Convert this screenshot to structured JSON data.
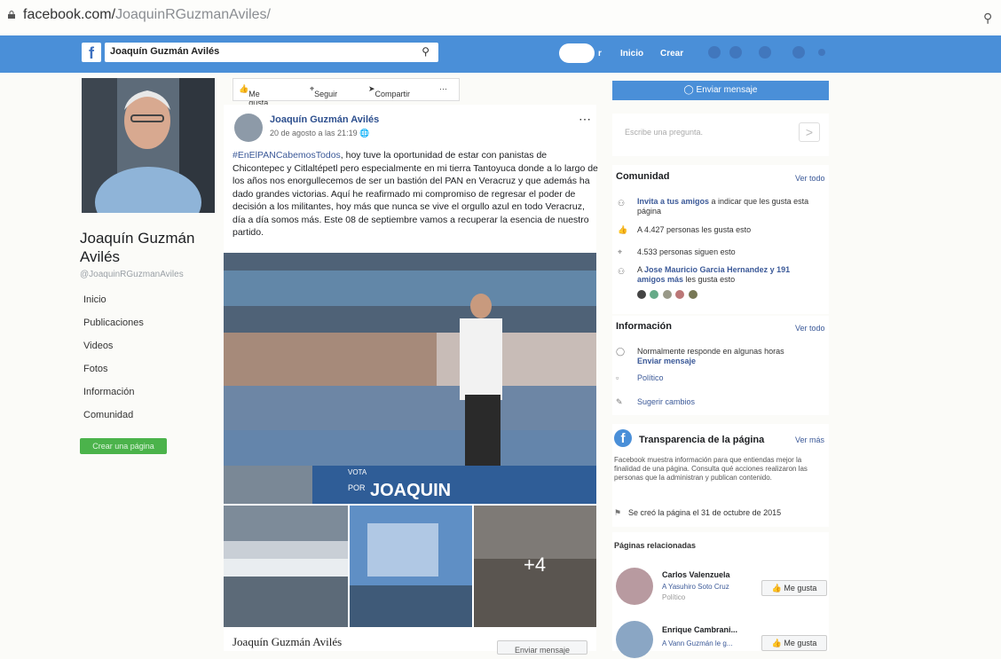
{
  "browser": {
    "url_domain": "facebook.com/",
    "url_path": "JoaquinRGuzmanAviles/"
  },
  "topbar": {
    "search_value": "Joaquín Guzmán Avilés",
    "nav": [
      "r",
      "Inicio",
      "Crear"
    ]
  },
  "profile": {
    "name": "Joaquín Guzmán Avilés",
    "handle": "@JoaquinRGuzmanAviles",
    "nav": [
      "Inicio",
      "Publicaciones",
      "Videos",
      "Fotos",
      "Información",
      "Comunidad"
    ],
    "create_page": "Crear una página"
  },
  "actions": {
    "like": "Me gusta",
    "follow": "Seguir",
    "share": "Compartir",
    "more": "···"
  },
  "post": {
    "author": "Joaquín Guzmán Avilés",
    "date": "20 de agosto a las 21:19",
    "hashtag": "#EnElPANCabemosTodos",
    "text": ", hoy tuve la oportunidad de estar con panistas de Chicontepec y Citlaltépetl pero especialmente en mi tierra Tantoyuca donde a lo largo de los años nos enorgullecemos de ser un bastión del PAN en Veracruz y que además ha dado grandes victorias. Aquí he reafirmado mi compromiso de regresar el poder de decisión a los militantes, hoy más que nunca se vive el orgullo azul en todo Veracruz, día a día somos más. Este 08 de septiembre vamos a recuperar la esencia de nuestro partido.",
    "banner_small": "VOTA",
    "banner_por": "POR",
    "banner_big": "JOAQUIN",
    "more_photos": "+4"
  },
  "footer": {
    "name": "Joaquín Guzmán Avilés",
    "button": "Enviar mensaje"
  },
  "right": {
    "send_message": "Enviar mensaje",
    "ask_placeholder": "Escribe una pregunta.",
    "community": {
      "title": "Comunidad",
      "see_all": "Ver todo",
      "invite_link": "Invita a tus amigos",
      "invite_rest": "a indicar que les gusta esta página",
      "likes": "A 4.427 personas les gusta esto",
      "follows": "4.533 personas siguen esto",
      "friends_a": "A",
      "friends_link": "Jose Mauricio Garcia Hernandez y 191 amigos más",
      "friends_rest": "les gusta esto"
    },
    "info": {
      "title": "Información",
      "see_all": "Ver todo",
      "responds": "Normalmente responde en algunas horas",
      "send": "Enviar mensaje",
      "category": "Político",
      "suggest": "Sugerir cambios"
    },
    "transparency": {
      "title": "Transparencia de la página",
      "see_more": "Ver más",
      "body": "Facebook muestra información para que entiendas mejor la finalidad de una página. Consulta qué acciones realizaron las personas que la administran y publican contenido.",
      "created": "Se creó la página el 31 de octubre de 2015"
    },
    "related": {
      "title": "Páginas relacionadas",
      "items": [
        {
          "name": "Carlos Valenzuela",
          "sub": "A Yasuhiro Soto Cruz",
          "sub2": "Político",
          "button": "Me gusta"
        },
        {
          "name": "Enrique Cambrani...",
          "sub": "A Vann Guzmán le g...",
          "sub2": "",
          "button": "Me gusta"
        }
      ]
    }
  }
}
